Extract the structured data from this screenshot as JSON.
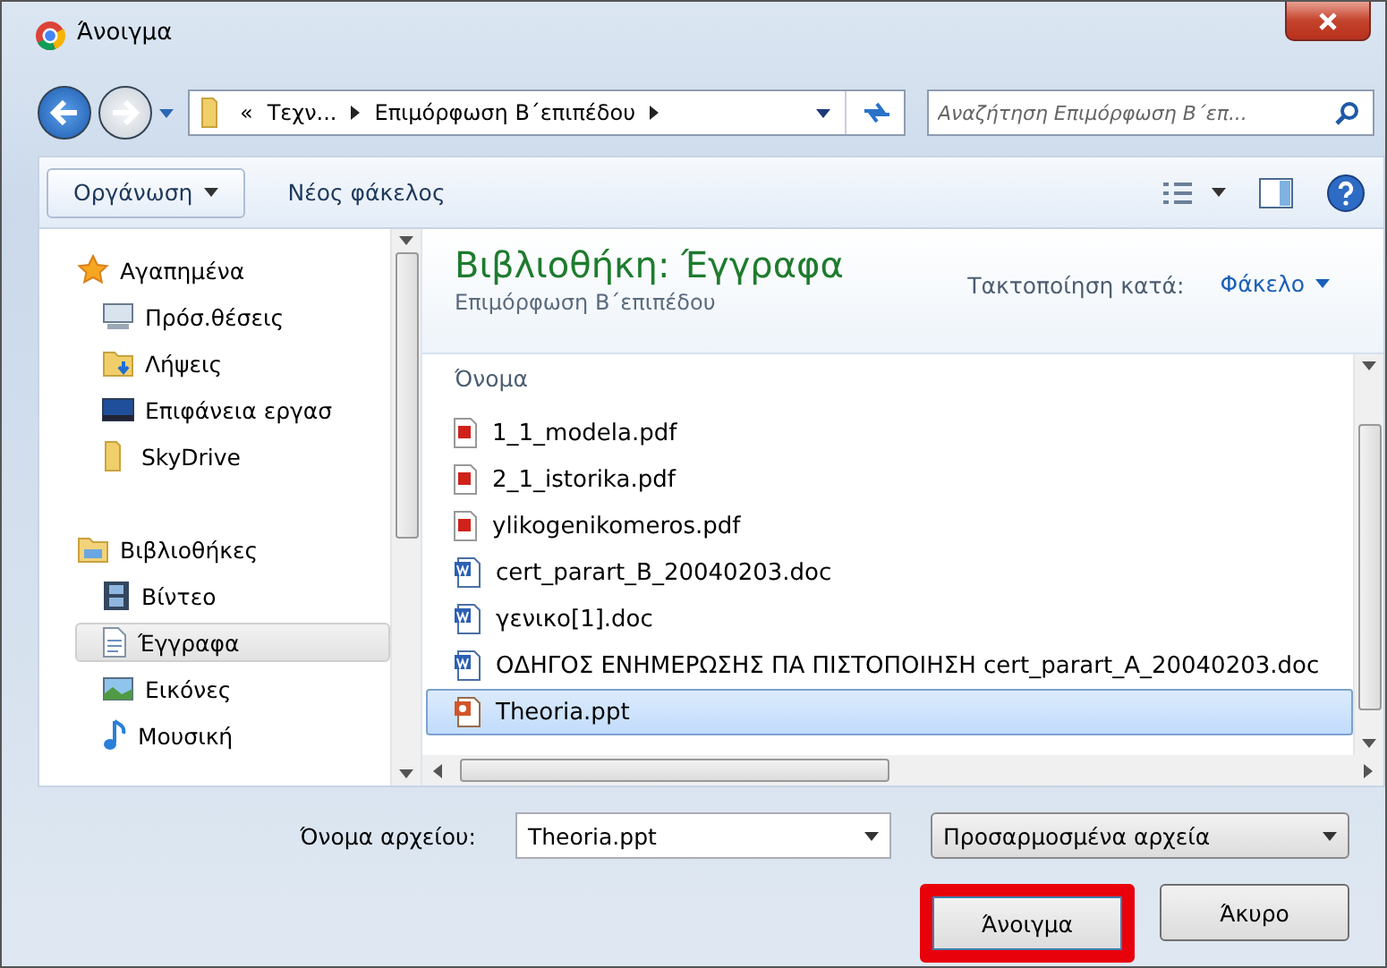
{
  "window": {
    "title": "Άνοιγμα"
  },
  "address": {
    "overflow": "«",
    "segments": [
      "Τεχν...",
      "Επιμόρφωση Β΄επιπέδου"
    ]
  },
  "search": {
    "placeholder": "Αναζήτηση Επιμόρφωση Β΄επ..."
  },
  "toolbar": {
    "organize": "Οργάνωση",
    "new_folder": "Νέος φάκελος"
  },
  "sidebar": {
    "groups": [
      {
        "label": "Αγαπημένα",
        "children": [
          {
            "label": "Πρόσ.θέσεις",
            "selected": false
          },
          {
            "label": "Λήψεις",
            "selected": false
          },
          {
            "label": "Επιφάνεια εργασ",
            "selected": false
          },
          {
            "label": "SkyDrive",
            "selected": false
          }
        ]
      },
      {
        "label": "Βιβλιοθήκες",
        "children": [
          {
            "label": "Βίντεο",
            "selected": false
          },
          {
            "label": "Έγγραφα",
            "selected": true
          },
          {
            "label": "Εικόνες",
            "selected": false
          },
          {
            "label": "Μουσική",
            "selected": false
          }
        ]
      }
    ]
  },
  "library": {
    "title": "Βιβλιοθήκη: Έγγραφα",
    "subtitle": "Επιμόρφωση Β΄επιπέδου",
    "arrange_label": "Τακτοποίηση κατά:",
    "arrange_value": "Φάκελο"
  },
  "file_list": {
    "column": "Όνομα",
    "files": [
      {
        "name": "1_1_modela.pdf",
        "kind": "pdf",
        "selected": false
      },
      {
        "name": "2_1_istorika.pdf",
        "kind": "pdf",
        "selected": false
      },
      {
        "name": "ylikogenikomeros.pdf",
        "kind": "pdf",
        "selected": false
      },
      {
        "name": "cert_parart_B_20040203.doc",
        "kind": "doc",
        "selected": false
      },
      {
        "name": "γενικο[1].doc",
        "kind": "doc",
        "selected": false
      },
      {
        "name": "ΟΔΗΓΟΣ ΕΝΗΜΕΡΩΣΗΣ ΠΑ ΠΙΣΤΟΠΟΙΗΣΗ cert_parart_A_20040203.doc",
        "kind": "doc",
        "selected": false
      },
      {
        "name": "Theoria.ppt",
        "kind": "ppt",
        "selected": true
      }
    ]
  },
  "footer": {
    "filename_label": "Όνομα αρχείου:",
    "filename_value": "Theoria.ppt",
    "filter": "Προσαρμοσμένα αρχεία",
    "buttons": [
      {
        "label": "Άνοιγμα",
        "highlighted": true
      },
      {
        "label": "Άκυρο",
        "highlighted": false
      }
    ]
  }
}
